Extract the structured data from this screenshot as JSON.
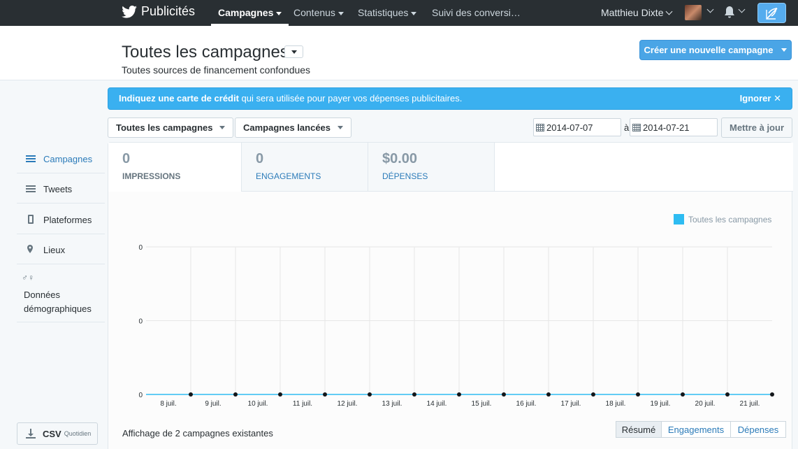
{
  "topbar": {
    "brand": "Publicités",
    "nav": [
      {
        "label": "Campagnes",
        "active": true
      },
      {
        "label": "Contenus"
      },
      {
        "label": "Statistiques"
      },
      {
        "label": "Suivi des conversi…"
      }
    ],
    "user": "Matthieu Dixte"
  },
  "header": {
    "title": "Toutes les campagnes",
    "subtitle": "Toutes sources de financement confondues",
    "create_label": "Créer une nouvelle campagne"
  },
  "alert": {
    "bold": "Indiquez une carte de crédit",
    "text": " qui sera utilisée pour payer vos dépenses publicitaires.",
    "ignore": "Ignorer",
    "color": "#3ab0f0"
  },
  "filters": {
    "campaigns": "Toutes les campagnes",
    "status": "Campagnes lancées",
    "date_from": "2014-07-07",
    "date_sep": "à",
    "date_to": "2014-07-21",
    "update": "Mettre à jour"
  },
  "sidebar": {
    "items": [
      {
        "label": "Campagnes",
        "icon": "list-icon",
        "active": true
      },
      {
        "label": "Tweets",
        "icon": "list-icon"
      },
      {
        "label": "Plateformes",
        "icon": "phone-icon"
      },
      {
        "label": "Lieux",
        "icon": "pin-icon"
      },
      {
        "label": "Données démographiques",
        "icon": "gender-icon"
      }
    ],
    "csv": "CSV",
    "csv_sub": "Quotidien"
  },
  "tabs": [
    {
      "value": "0",
      "label": "IMPRESSIONS",
      "active": true
    },
    {
      "value": "0",
      "label": "ENGAGEMENTS"
    },
    {
      "value": "$0.00",
      "label": "DÉPENSES"
    }
  ],
  "chart_data": {
    "type": "line",
    "legend": "Toutes les campagnes",
    "legend_color": "#2ebcf2",
    "x": [
      "8 juil.",
      "9 juil.",
      "10 juil.",
      "11 juil.",
      "12 juil.",
      "13 juil.",
      "14 juil.",
      "15 juil.",
      "16 juil.",
      "17 juil.",
      "18 juil.",
      "19 juil.",
      "20 juil.",
      "21 juil."
    ],
    "series": [
      {
        "name": "Toutes les campagnes",
        "values": [
          0,
          0,
          0,
          0,
          0,
          0,
          0,
          0,
          0,
          0,
          0,
          0,
          0,
          0,
          0
        ]
      }
    ],
    "y_tick_labels": [
      "0",
      "0",
      "0"
    ],
    "grid": true
  },
  "footer": {
    "note": "Affichage de 2 campagnes existantes",
    "views": [
      "Résumé",
      "Engagements",
      "Dépenses"
    ]
  }
}
